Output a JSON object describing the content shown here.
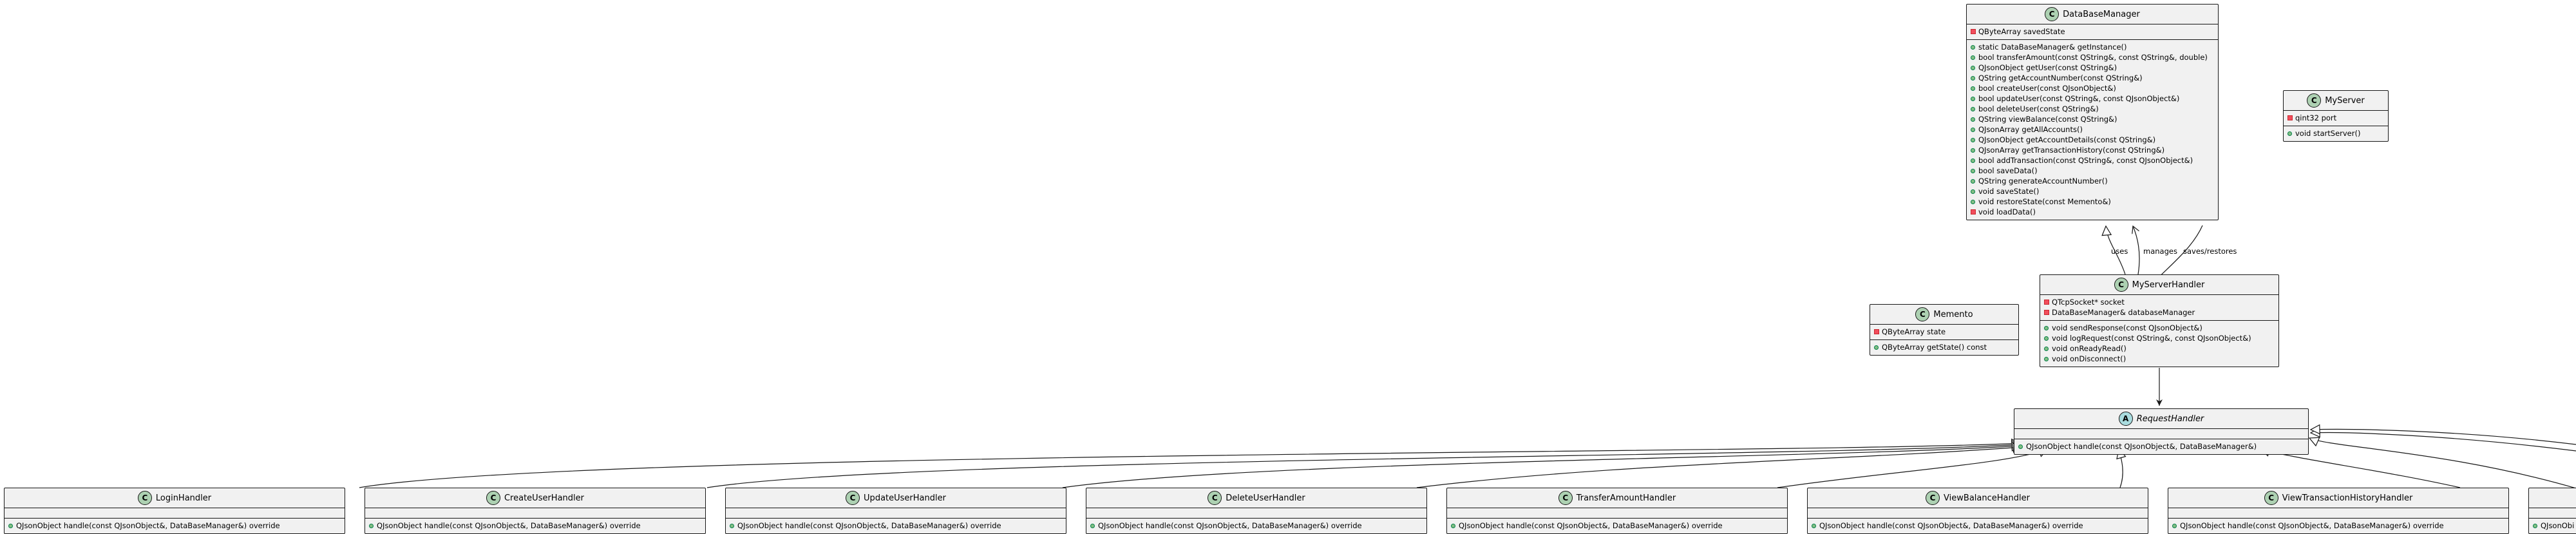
{
  "classes": {
    "database_manager": {
      "badge": "C",
      "name": "DataBaseManager",
      "attributes": [
        {
          "vis": "private",
          "text": "QByteArray savedState"
        }
      ],
      "methods": [
        {
          "vis": "public",
          "text": "static DataBaseManager& getInstance()"
        },
        {
          "vis": "public",
          "text": "bool transferAmount(const QString&, const QString&, double)"
        },
        {
          "vis": "public",
          "text": "QJsonObject getUser(const QString&)"
        },
        {
          "vis": "public",
          "text": "QString getAccountNumber(const QString&)"
        },
        {
          "vis": "public",
          "text": "bool createUser(const QJsonObject&)"
        },
        {
          "vis": "public",
          "text": "bool updateUser(const QString&, const QJsonObject&)"
        },
        {
          "vis": "public",
          "text": "bool deleteUser(const QString&)"
        },
        {
          "vis": "public",
          "text": "QString viewBalance(const QString&)"
        },
        {
          "vis": "public",
          "text": "QJsonArray getAllAccounts()"
        },
        {
          "vis": "public",
          "text": "QJsonObject getAccountDetails(const QString&)"
        },
        {
          "vis": "public",
          "text": "QJsonArray getTransactionHistory(const QString&)"
        },
        {
          "vis": "public",
          "text": "bool addTransaction(const QString&, const QJsonObject&)"
        },
        {
          "vis": "public",
          "text": "bool saveData()"
        },
        {
          "vis": "public",
          "text": "QString generateAccountNumber()"
        },
        {
          "vis": "public",
          "text": "void saveState()"
        },
        {
          "vis": "public",
          "text": "void restoreState(const Memento&)"
        },
        {
          "vis": "private",
          "text": "void loadData()"
        }
      ]
    },
    "my_server": {
      "badge": "C",
      "name": "MyServer",
      "attributes": [
        {
          "vis": "private",
          "text": "qint32 port"
        }
      ],
      "methods": [
        {
          "vis": "public",
          "text": "void startServer()"
        }
      ]
    },
    "memento": {
      "badge": "C",
      "name": "Memento",
      "attributes": [
        {
          "vis": "private",
          "text": "QByteArray state"
        }
      ],
      "methods": [
        {
          "vis": "public",
          "text": "QByteArray getState() const"
        }
      ]
    },
    "my_server_handler": {
      "badge": "C",
      "name": "MyServerHandler",
      "attributes": [
        {
          "vis": "private",
          "text": "QTcpSocket* socket"
        },
        {
          "vis": "private",
          "text": "DataBaseManager& databaseManager"
        }
      ],
      "methods": [
        {
          "vis": "public",
          "text": "void sendResponse(const QJsonObject&)"
        },
        {
          "vis": "public",
          "text": "void logRequest(const QString&, const QJsonObject&)"
        },
        {
          "vis": "public",
          "text": "void onReadyRead()"
        },
        {
          "vis": "public",
          "text": "void onDisconnect()"
        }
      ]
    },
    "request_handler": {
      "badge": "A",
      "name": "RequestHandler",
      "attributes": [],
      "methods": [
        {
          "vis": "public",
          "text": "QJsonObject handle(const QJsonObject&, DataBaseManager&)"
        }
      ]
    },
    "login_handler": {
      "badge": "C",
      "name": "LoginHandler",
      "attributes": [],
      "methods": [
        {
          "vis": "public",
          "text": "QJsonObject handle(const QJsonObject&, DataBaseManager&) override"
        }
      ]
    },
    "create_user_handler": {
      "badge": "C",
      "name": "CreateUserHandler",
      "attributes": [],
      "methods": [
        {
          "vis": "public",
          "text": "QJsonObject handle(const QJsonObject&, DataBaseManager&) override"
        }
      ]
    },
    "update_user_handler": {
      "badge": "C",
      "name": "UpdateUserHandler",
      "attributes": [],
      "methods": [
        {
          "vis": "public",
          "text": "QJsonObject handle(const QJsonObject&, DataBaseManager&) override"
        }
      ]
    },
    "delete_user_handler": {
      "badge": "C",
      "name": "DeleteUserHandler",
      "attributes": [],
      "methods": [
        {
          "vis": "public",
          "text": "QJsonObject handle(const QJsonObject&, DataBaseManager&) override"
        }
      ]
    },
    "transfer_amount_handler": {
      "badge": "C",
      "name": "TransferAmountHandler",
      "attributes": [],
      "methods": [
        {
          "vis": "public",
          "text": "QJsonObject handle(const QJsonObject&, DataBaseManager&) override"
        }
      ]
    },
    "view_balance_handler": {
      "badge": "C",
      "name": "ViewBalanceHandler",
      "attributes": [],
      "methods": [
        {
          "vis": "public",
          "text": "QJsonObject handle(const QJsonObject&, DataBaseManager&) override"
        }
      ]
    },
    "view_transaction_history_handler": {
      "badge": "C",
      "name": "ViewTransactionHistoryHandler",
      "attributes": [],
      "methods": [
        {
          "vis": "public",
          "text": "QJsonObject handle(const QJsonObject&, DataBaseManager&) override"
        }
      ]
    },
    "partial_handler": {
      "badge": "",
      "name": "",
      "attributes": [],
      "methods": [
        {
          "vis": "public",
          "text": "QJsonObi"
        }
      ]
    }
  },
  "relations": {
    "saves_restores": "saves/restores",
    "uses": "uses",
    "manages": "manages"
  },
  "colors": {
    "class_fill": "#f1f1f1",
    "border": "#181818",
    "class_badge": "#add1b2",
    "abstract_badge": "#a9dcdf",
    "public_marker": "#84be84",
    "private_marker": "#f24d5c"
  }
}
